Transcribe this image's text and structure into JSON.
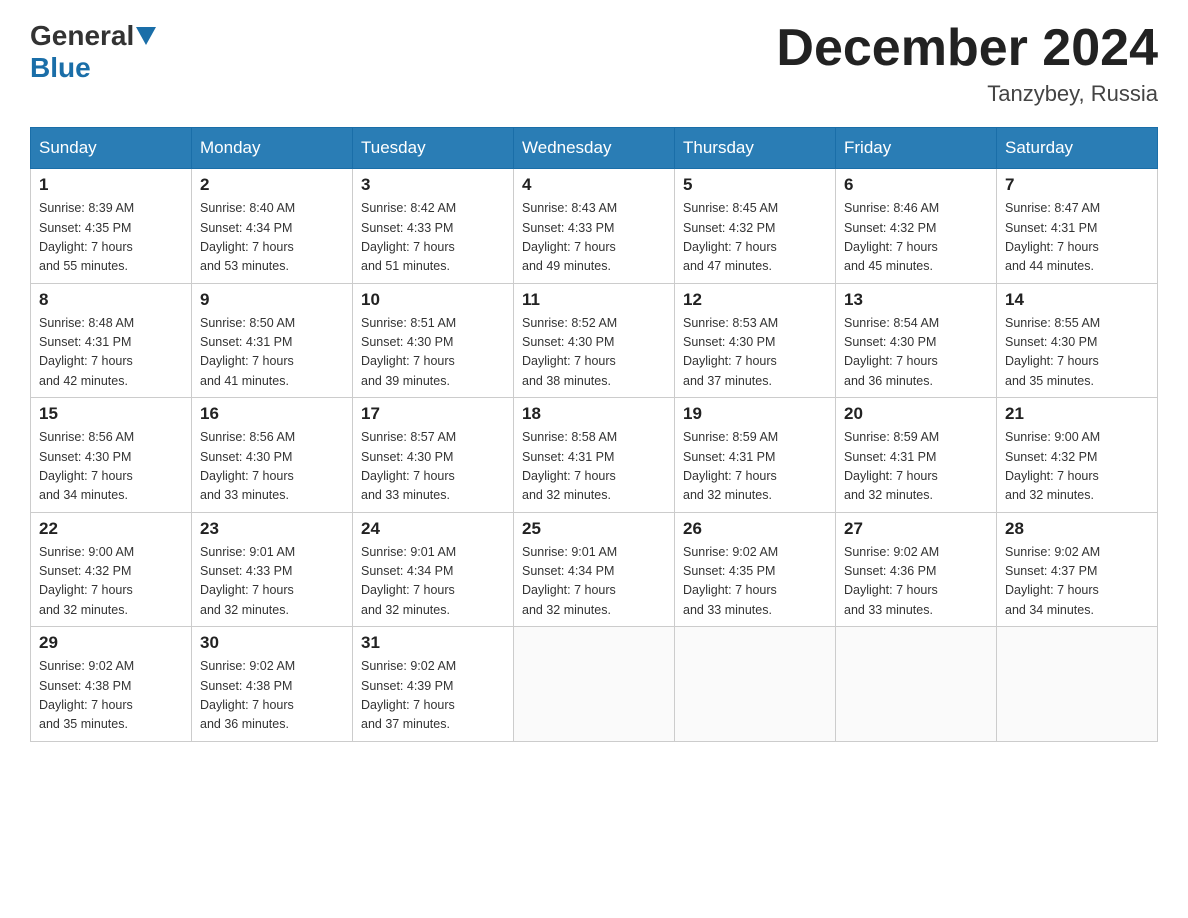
{
  "header": {
    "logo_general": "General",
    "logo_blue": "Blue",
    "month_title": "December 2024",
    "location": "Tanzybey, Russia"
  },
  "weekdays": [
    "Sunday",
    "Monday",
    "Tuesday",
    "Wednesday",
    "Thursday",
    "Friday",
    "Saturday"
  ],
  "weeks": [
    [
      {
        "day": "1",
        "info": "Sunrise: 8:39 AM\nSunset: 4:35 PM\nDaylight: 7 hours\nand 55 minutes."
      },
      {
        "day": "2",
        "info": "Sunrise: 8:40 AM\nSunset: 4:34 PM\nDaylight: 7 hours\nand 53 minutes."
      },
      {
        "day": "3",
        "info": "Sunrise: 8:42 AM\nSunset: 4:33 PM\nDaylight: 7 hours\nand 51 minutes."
      },
      {
        "day": "4",
        "info": "Sunrise: 8:43 AM\nSunset: 4:33 PM\nDaylight: 7 hours\nand 49 minutes."
      },
      {
        "day": "5",
        "info": "Sunrise: 8:45 AM\nSunset: 4:32 PM\nDaylight: 7 hours\nand 47 minutes."
      },
      {
        "day": "6",
        "info": "Sunrise: 8:46 AM\nSunset: 4:32 PM\nDaylight: 7 hours\nand 45 minutes."
      },
      {
        "day": "7",
        "info": "Sunrise: 8:47 AM\nSunset: 4:31 PM\nDaylight: 7 hours\nand 44 minutes."
      }
    ],
    [
      {
        "day": "8",
        "info": "Sunrise: 8:48 AM\nSunset: 4:31 PM\nDaylight: 7 hours\nand 42 minutes."
      },
      {
        "day": "9",
        "info": "Sunrise: 8:50 AM\nSunset: 4:31 PM\nDaylight: 7 hours\nand 41 minutes."
      },
      {
        "day": "10",
        "info": "Sunrise: 8:51 AM\nSunset: 4:30 PM\nDaylight: 7 hours\nand 39 minutes."
      },
      {
        "day": "11",
        "info": "Sunrise: 8:52 AM\nSunset: 4:30 PM\nDaylight: 7 hours\nand 38 minutes."
      },
      {
        "day": "12",
        "info": "Sunrise: 8:53 AM\nSunset: 4:30 PM\nDaylight: 7 hours\nand 37 minutes."
      },
      {
        "day": "13",
        "info": "Sunrise: 8:54 AM\nSunset: 4:30 PM\nDaylight: 7 hours\nand 36 minutes."
      },
      {
        "day": "14",
        "info": "Sunrise: 8:55 AM\nSunset: 4:30 PM\nDaylight: 7 hours\nand 35 minutes."
      }
    ],
    [
      {
        "day": "15",
        "info": "Sunrise: 8:56 AM\nSunset: 4:30 PM\nDaylight: 7 hours\nand 34 minutes."
      },
      {
        "day": "16",
        "info": "Sunrise: 8:56 AM\nSunset: 4:30 PM\nDaylight: 7 hours\nand 33 minutes."
      },
      {
        "day": "17",
        "info": "Sunrise: 8:57 AM\nSunset: 4:30 PM\nDaylight: 7 hours\nand 33 minutes."
      },
      {
        "day": "18",
        "info": "Sunrise: 8:58 AM\nSunset: 4:31 PM\nDaylight: 7 hours\nand 32 minutes."
      },
      {
        "day": "19",
        "info": "Sunrise: 8:59 AM\nSunset: 4:31 PM\nDaylight: 7 hours\nand 32 minutes."
      },
      {
        "day": "20",
        "info": "Sunrise: 8:59 AM\nSunset: 4:31 PM\nDaylight: 7 hours\nand 32 minutes."
      },
      {
        "day": "21",
        "info": "Sunrise: 9:00 AM\nSunset: 4:32 PM\nDaylight: 7 hours\nand 32 minutes."
      }
    ],
    [
      {
        "day": "22",
        "info": "Sunrise: 9:00 AM\nSunset: 4:32 PM\nDaylight: 7 hours\nand 32 minutes."
      },
      {
        "day": "23",
        "info": "Sunrise: 9:01 AM\nSunset: 4:33 PM\nDaylight: 7 hours\nand 32 minutes."
      },
      {
        "day": "24",
        "info": "Sunrise: 9:01 AM\nSunset: 4:34 PM\nDaylight: 7 hours\nand 32 minutes."
      },
      {
        "day": "25",
        "info": "Sunrise: 9:01 AM\nSunset: 4:34 PM\nDaylight: 7 hours\nand 32 minutes."
      },
      {
        "day": "26",
        "info": "Sunrise: 9:02 AM\nSunset: 4:35 PM\nDaylight: 7 hours\nand 33 minutes."
      },
      {
        "day": "27",
        "info": "Sunrise: 9:02 AM\nSunset: 4:36 PM\nDaylight: 7 hours\nand 33 minutes."
      },
      {
        "day": "28",
        "info": "Sunrise: 9:02 AM\nSunset: 4:37 PM\nDaylight: 7 hours\nand 34 minutes."
      }
    ],
    [
      {
        "day": "29",
        "info": "Sunrise: 9:02 AM\nSunset: 4:38 PM\nDaylight: 7 hours\nand 35 minutes."
      },
      {
        "day": "30",
        "info": "Sunrise: 9:02 AM\nSunset: 4:38 PM\nDaylight: 7 hours\nand 36 minutes."
      },
      {
        "day": "31",
        "info": "Sunrise: 9:02 AM\nSunset: 4:39 PM\nDaylight: 7 hours\nand 37 minutes."
      },
      {
        "day": "",
        "info": ""
      },
      {
        "day": "",
        "info": ""
      },
      {
        "day": "",
        "info": ""
      },
      {
        "day": "",
        "info": ""
      }
    ]
  ]
}
